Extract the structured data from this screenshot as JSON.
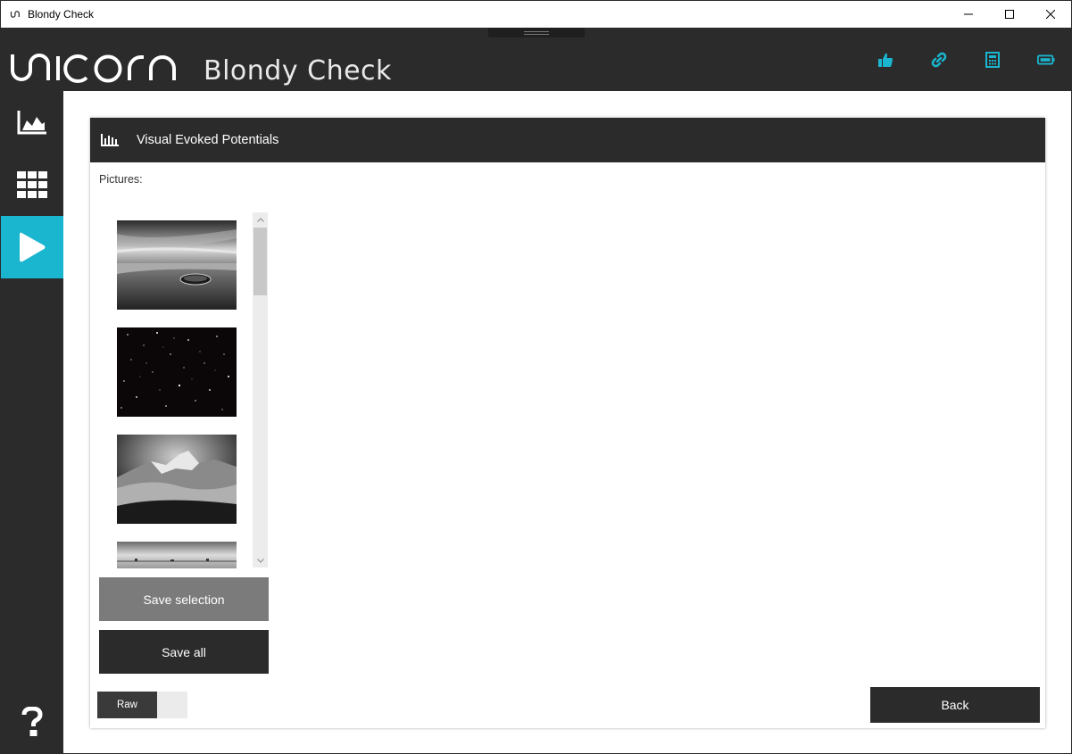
{
  "window": {
    "title": "Blondy Check"
  },
  "header": {
    "logo_text": "unicorn",
    "subtitle": "Blondy Check",
    "icons": [
      "thumbs-up-icon",
      "link-icon",
      "calculator-icon",
      "battery-icon"
    ],
    "accent_color": "#1ab5cf"
  },
  "sidebar": {
    "items": [
      {
        "icon": "chart-area-icon",
        "active": false
      },
      {
        "icon": "grid-icon",
        "active": false
      },
      {
        "icon": "play-icon",
        "active": true
      },
      {
        "icon": "help-icon",
        "active": false
      }
    ]
  },
  "panel": {
    "title": "Visual Evoked Potentials",
    "pictures_label": "Pictures:",
    "pictures": [
      "beach-boat-image",
      "starfield-image",
      "mountains-image",
      "horizon-image"
    ],
    "save_selection_label": "Save selection",
    "save_all_label": "Save all",
    "toggle_label": "Raw",
    "back_label": "Back"
  }
}
